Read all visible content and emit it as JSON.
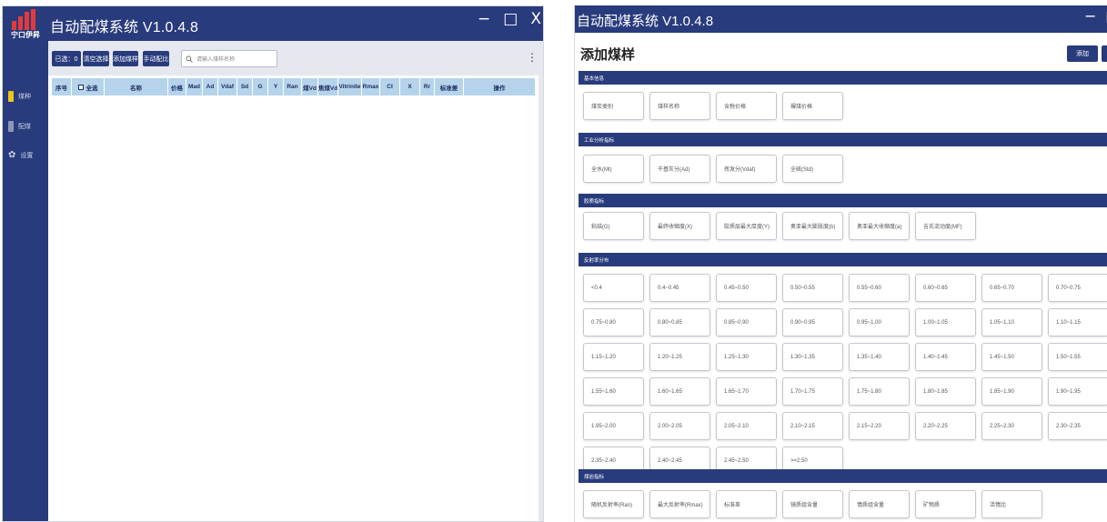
{
  "left_window": {
    "title": "自动配煤系统 V1.0.4.8",
    "logo_text": "宁口伊昇",
    "logo_subtext": "XXXXXXXXXXXXXXXX",
    "window_controls": [
      "−",
      "□",
      "X"
    ],
    "sidebar": [
      {
        "icon": "coal-icon",
        "label": "煤种",
        "color": "#f0c419"
      },
      {
        "icon": "blend-icon",
        "label": "配煤",
        "color": "#8c96b8"
      },
      {
        "icon": "gear-icon",
        "label": "设置",
        "color": "#8c96b8"
      }
    ],
    "toolbar": {
      "selected_count": "已选：0",
      "clear_selection": "清空选择",
      "add_coal": "添加煤样",
      "manual_blend": "手动配比",
      "search_placeholder": "请输入煤样名称",
      "more": "⋮"
    },
    "table_columns": [
      "序号",
      "全选",
      "名称",
      "价格",
      "Mad",
      "Ad",
      "Vdaf",
      "Sd",
      "G",
      "Y",
      "Ran",
      "煤Vd",
      "焦煤Vd",
      "Vitrinite",
      "Rmax",
      "CI",
      "X",
      "Rr",
      "标准差",
      "操作"
    ]
  },
  "right_window": {
    "title": "自动配煤系统 V1.0.4.8",
    "window_controls": [
      "−",
      "□"
    ],
    "heading": "添加煤样",
    "add_button": "添加",
    "sections": [
      {
        "title": "基本信息",
        "fields": [
          "煤炭类别",
          "煤样名称",
          "含税价格",
          "裸煤价格"
        ]
      },
      {
        "title": "工业分析指标",
        "fields": [
          "全水(Mt)",
          "干基灰分(Ad)",
          "挥发分(Vdaf)",
          "全硫(Std)"
        ]
      },
      {
        "title": "胶质指标",
        "fields": [
          "粘结(G)",
          "最终收缩度(X)",
          "胶质层最大厚度(Y)",
          "奥亚最大膨胀度(b)",
          "奥亚最大收缩度(a)",
          "吉氏流动度(MF)"
        ]
      },
      {
        "title": "反射率分布",
        "fields": [
          "<0.4",
          "0.4~0.45",
          "0.45~0.50",
          "0.50~0.55",
          "0.55~0.60",
          "0.60~0.65",
          "0.65~0.70",
          "0.70~0.75",
          "0.75~0.80",
          "0.80~0.85",
          "0.85~0.90",
          "0.90~0.95",
          "0.95~1.00",
          "1.00~1.05",
          "1.05~1.10",
          "1.10~1.15",
          "1.15~1.20",
          "1.20~1.25",
          "1.25~1.30",
          "1.30~1.35",
          "1.35~1.40",
          "1.40~1.45",
          "1.45~1.50",
          "1.50~1.55",
          "1.55~1.60",
          "1.60~1.65",
          "1.65~1.70",
          "1.70~1.75",
          "1.75~1.80",
          "1.80~1.85",
          "1.85~1.90",
          "1.90~1.95",
          "1.95~2.00",
          "2.00~2.05",
          "2.05~2.10",
          "2.10~2.15",
          "2.15~2.20",
          "2.20~2.25",
          "2.25~2.30",
          "2.30~2.35",
          "2.35~2.40",
          "2.40~2.45",
          "2.45~2.50",
          ">=2.50"
        ]
      },
      {
        "title": "煤岩指标",
        "fields": [
          "随机反射率(Ran)",
          "最大反射率(Rmax)",
          "标准差",
          "镜质组含量",
          "惰质组含量",
          "矿物质",
          "活惰比"
        ]
      }
    ]
  },
  "colors": {
    "titlebar": "#283b7c",
    "table_header": "#b5d4ec",
    "toolbar_bg": "#e6e8ef"
  }
}
